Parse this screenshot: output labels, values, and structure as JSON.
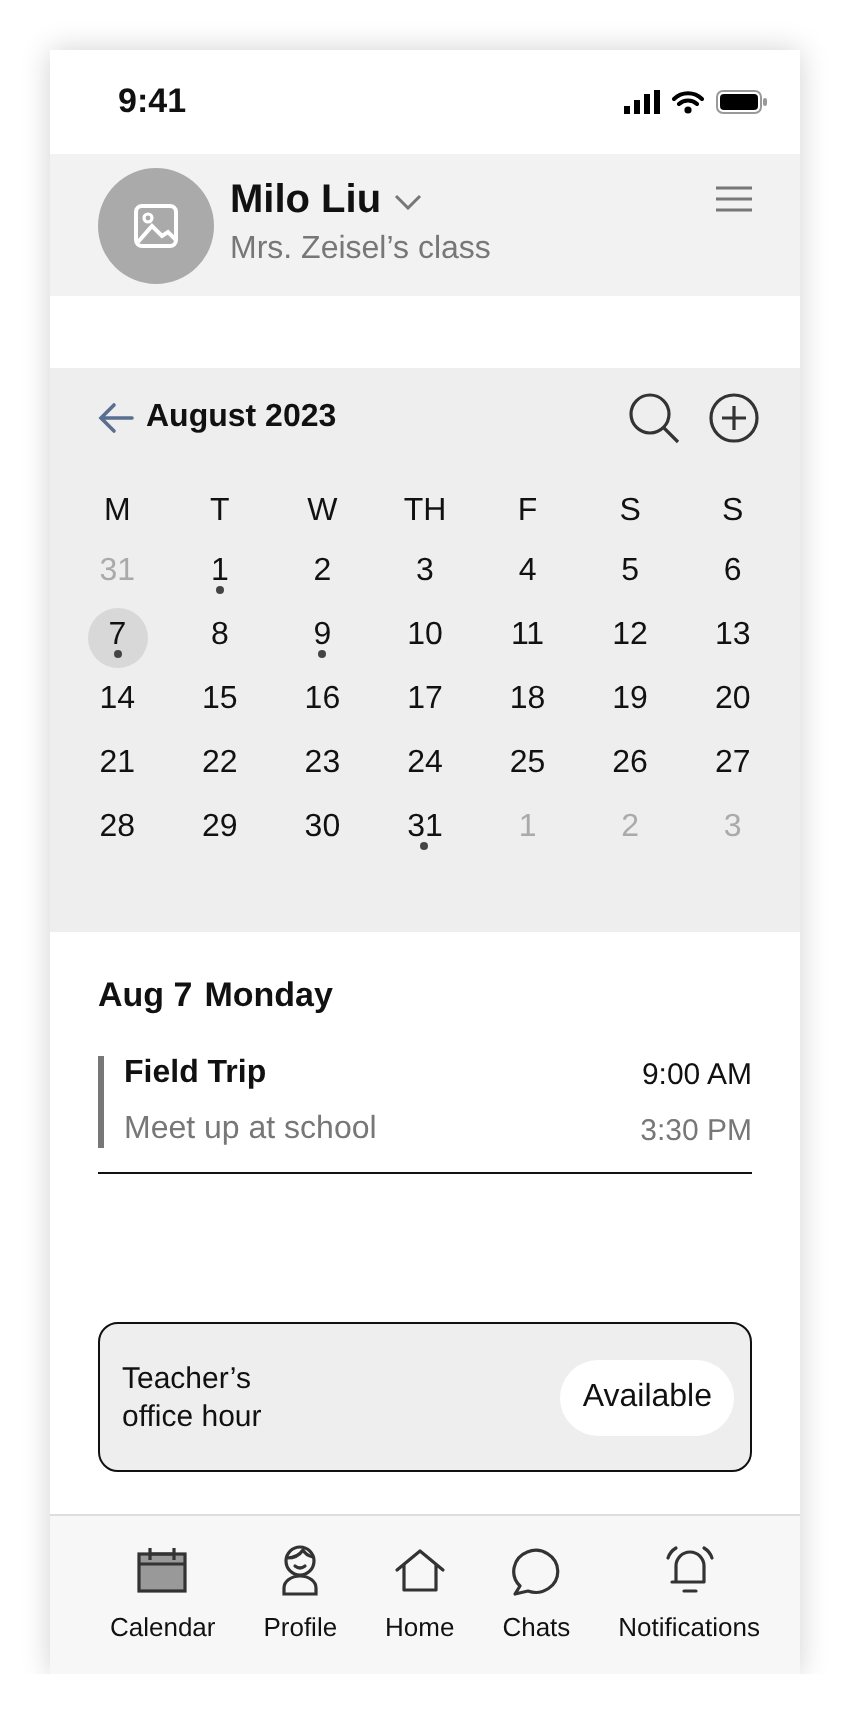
{
  "status_bar": {
    "time": "9:41"
  },
  "header": {
    "name": "Milo Liu",
    "subtitle": "Mrs. Zeisel’s class"
  },
  "calendar": {
    "month": "August 2023",
    "weekdays": [
      "M",
      "T",
      "W",
      "TH",
      "F",
      "S",
      "S"
    ],
    "days": [
      {
        "label": "31",
        "muted": true,
        "selected": false,
        "event": false
      },
      {
        "label": "1",
        "muted": false,
        "selected": false,
        "event": true
      },
      {
        "label": "2",
        "muted": false,
        "selected": false,
        "event": false
      },
      {
        "label": "3",
        "muted": false,
        "selected": false,
        "event": false
      },
      {
        "label": "4",
        "muted": false,
        "selected": false,
        "event": false
      },
      {
        "label": "5",
        "muted": false,
        "selected": false,
        "event": false
      },
      {
        "label": "6",
        "muted": false,
        "selected": false,
        "event": false
      },
      {
        "label": "7",
        "muted": false,
        "selected": true,
        "event": true
      },
      {
        "label": "8",
        "muted": false,
        "selected": false,
        "event": false
      },
      {
        "label": "9",
        "muted": false,
        "selected": false,
        "event": true
      },
      {
        "label": "10",
        "muted": false,
        "selected": false,
        "event": false
      },
      {
        "label": "11",
        "muted": false,
        "selected": false,
        "event": false
      },
      {
        "label": "12",
        "muted": false,
        "selected": false,
        "event": false
      },
      {
        "label": "13",
        "muted": false,
        "selected": false,
        "event": false
      },
      {
        "label": "14",
        "muted": false,
        "selected": false,
        "event": false
      },
      {
        "label": "15",
        "muted": false,
        "selected": false,
        "event": false
      },
      {
        "label": "16",
        "muted": false,
        "selected": false,
        "event": false
      },
      {
        "label": "17",
        "muted": false,
        "selected": false,
        "event": false
      },
      {
        "label": "18",
        "muted": false,
        "selected": false,
        "event": false
      },
      {
        "label": "19",
        "muted": false,
        "selected": false,
        "event": false
      },
      {
        "label": "20",
        "muted": false,
        "selected": false,
        "event": false
      },
      {
        "label": "21",
        "muted": false,
        "selected": false,
        "event": false
      },
      {
        "label": "22",
        "muted": false,
        "selected": false,
        "event": false
      },
      {
        "label": "23",
        "muted": false,
        "selected": false,
        "event": false
      },
      {
        "label": "24",
        "muted": false,
        "selected": false,
        "event": false
      },
      {
        "label": "25",
        "muted": false,
        "selected": false,
        "event": false
      },
      {
        "label": "26",
        "muted": false,
        "selected": false,
        "event": false
      },
      {
        "label": "27",
        "muted": false,
        "selected": false,
        "event": false
      },
      {
        "label": "28",
        "muted": false,
        "selected": false,
        "event": false
      },
      {
        "label": "29",
        "muted": false,
        "selected": false,
        "event": false
      },
      {
        "label": "30",
        "muted": false,
        "selected": false,
        "event": false
      },
      {
        "label": "31",
        "muted": false,
        "selected": false,
        "event": true
      },
      {
        "label": "1",
        "muted": true,
        "selected": false,
        "event": false
      },
      {
        "label": "2",
        "muted": true,
        "selected": false,
        "event": false
      },
      {
        "label": "3",
        "muted": true,
        "selected": false,
        "event": false
      }
    ]
  },
  "agenda": {
    "date": "Aug 7",
    "weekday": "Monday",
    "events": [
      {
        "title": "Field Trip",
        "note": "Meet up at school",
        "start": "9:00 AM",
        "end": "3:30 PM"
      }
    ]
  },
  "office_hour": {
    "label": "Teacher’s office hour",
    "status": "Available"
  },
  "nav": [
    {
      "label": "Calendar",
      "selected": true
    },
    {
      "label": "Profile",
      "selected": false
    },
    {
      "label": "Home",
      "selected": false
    },
    {
      "label": "Chats",
      "selected": false
    },
    {
      "label": "Notifications",
      "selected": false
    }
  ]
}
